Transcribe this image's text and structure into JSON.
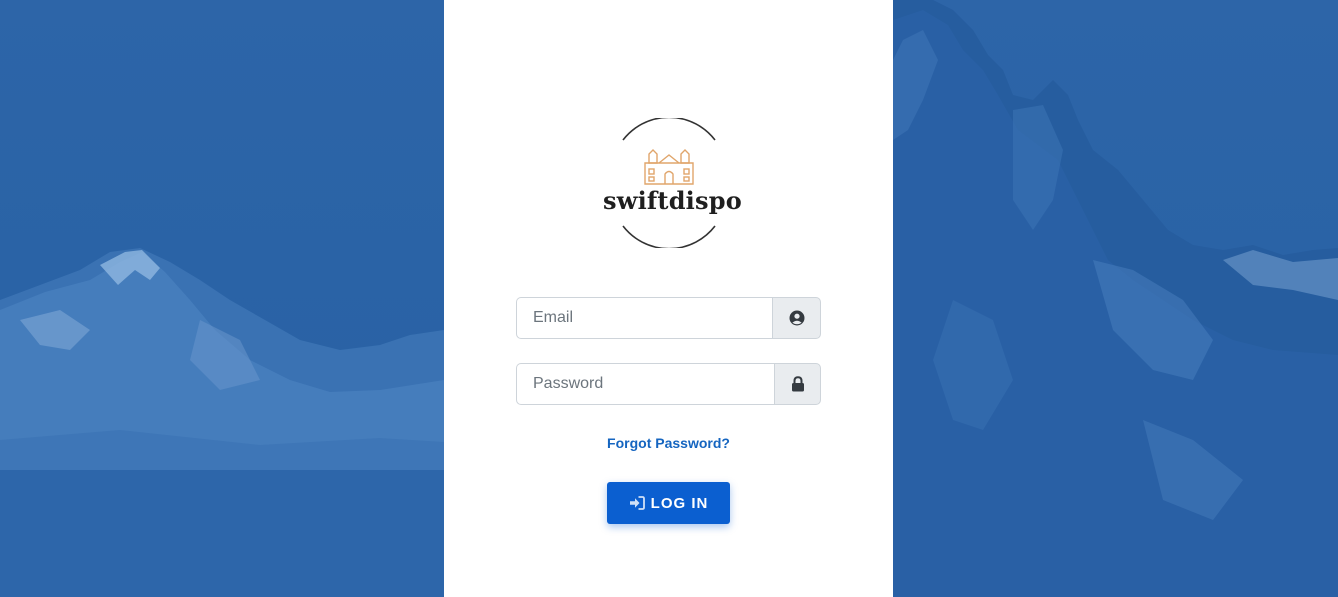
{
  "brand": {
    "name": "swiftdispo",
    "logo_icon": "house-icon",
    "logo_color": "#e0a56b"
  },
  "form": {
    "email_placeholder": "Email",
    "email_value": "",
    "email_icon": "user-circle-icon",
    "password_placeholder": "Password",
    "password_value": "",
    "password_icon": "lock-icon",
    "forgot_label": "Forgot Password?",
    "login_label": "LOG IN",
    "login_icon": "sign-in-icon"
  },
  "colors": {
    "background_overlay": "#2a63a6",
    "primary": "#0b5fd0",
    "link": "#1565c0"
  }
}
